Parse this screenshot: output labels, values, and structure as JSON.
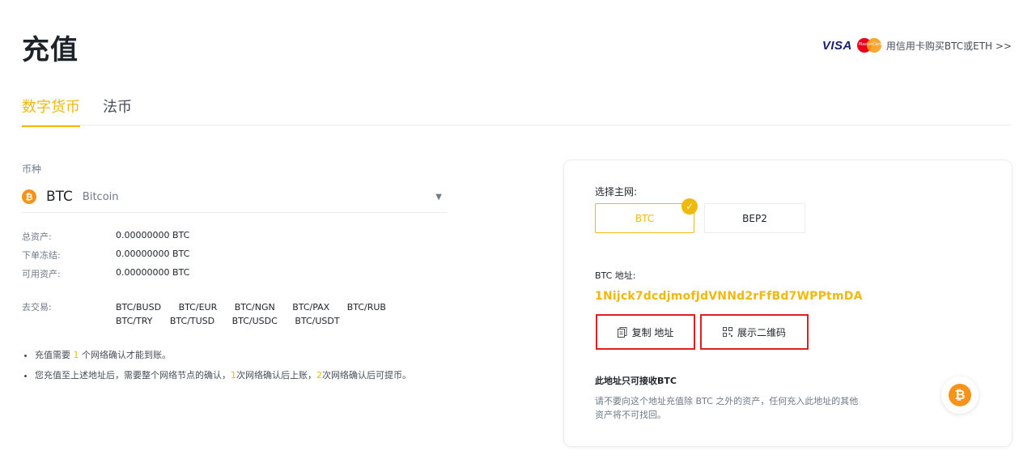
{
  "header": {
    "title": "充值",
    "card_purchase_link": "用信用卡购买BTC或ETH >>",
    "visa_logo_text": "VISA",
    "mastercard_logo_text": "MasterCard"
  },
  "tabs": [
    {
      "label": "数字货币",
      "active": true
    },
    {
      "label": "法币",
      "active": false
    }
  ],
  "coin": {
    "label": "币种",
    "icon_glyph": "₿",
    "symbol": "BTC",
    "name": "Bitcoin"
  },
  "balances": [
    {
      "label": "总资产:",
      "value": "0.00000000 BTC"
    },
    {
      "label": "下单冻结:",
      "value": "0.00000000 BTC"
    },
    {
      "label": "可用资产:",
      "value": "0.00000000 BTC"
    }
  ],
  "trade": {
    "label": "去交易:",
    "pairs_row1": [
      "BTC/BUSD",
      "BTC/EUR",
      "BTC/NGN",
      "BTC/PAX",
      "BTC/RUB"
    ],
    "pairs_row2": [
      "BTC/TRY",
      "BTC/TUSD",
      "BTC/USDC",
      "BTC/USDT"
    ]
  },
  "notes": {
    "n1_pre": "充值需要 ",
    "n1_num": "1",
    "n1_post": " 个网络确认才能到账。",
    "n2_pre": "您充值至上述地址后，需要整个网络节点的确认，",
    "n2_num1": "1",
    "n2_mid": "次网络确认后上账，",
    "n2_num2": "2",
    "n2_post": "次网络确认后可提币。"
  },
  "deposit": {
    "network_label": "选择主网:",
    "networks": [
      {
        "label": "BTC",
        "selected": true
      },
      {
        "label": "BEP2",
        "selected": false
      }
    ],
    "check_glyph": "✓",
    "address_label": "BTC 地址:",
    "address": "1Nijck7dcdjmofJdVNNd2rFfBd7WPPtmDA",
    "copy_label": "复制 地址",
    "qr_label": "展示二维码",
    "only_title": "此地址只可接收BTC",
    "only_desc": "请不要向这个地址充值除 BTC 之外的资产，任何充入此地址的其他资产将不可找回。"
  },
  "icons": {
    "copy": "document-copy-icon",
    "qr": "qr-code-icon",
    "caret": "caret-down-icon",
    "coin": "bitcoin-icon"
  },
  "colors": {
    "accent": "#f0b90b",
    "bitcoin": "#f7931a",
    "highlight_border": "#e02020"
  }
}
